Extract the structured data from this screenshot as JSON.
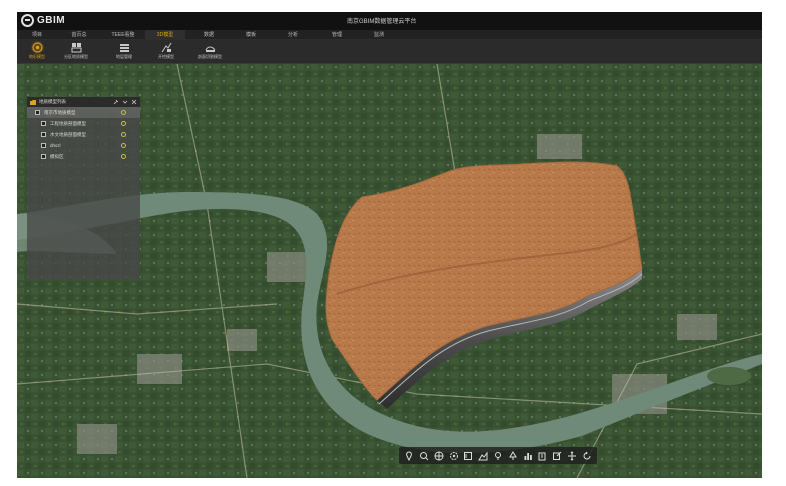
{
  "app": {
    "logo_text": "GBIM",
    "title": "南京GBIM数据管理云平台"
  },
  "menu": {
    "items": [
      {
        "label": "项目"
      },
      {
        "label": "首页总"
      },
      {
        "label": "TEEE看整"
      },
      {
        "label": "3D模型"
      },
      {
        "label": "数据"
      },
      {
        "label": "模板"
      },
      {
        "label": "分析"
      },
      {
        "label": "管理"
      },
      {
        "label": "监测"
      }
    ],
    "active_index": 3
  },
  "toolbar": {
    "tools": [
      {
        "label": "地形模型",
        "icon": "target-icon"
      },
      {
        "label": "分区地质模型",
        "icon": "grid-icon"
      },
      {
        "label": "地层管理",
        "icon": "layers-icon"
      },
      {
        "label": "开挖模型",
        "icon": "excavate-icon"
      },
      {
        "label": "剖面切割模型",
        "icon": "section-icon"
      }
    ],
    "active_index": 0
  },
  "panel": {
    "title": "地质模型列表",
    "rows": [
      {
        "label": "南京市地质模型",
        "selected": true
      },
      {
        "label": "工程地质剖面模型",
        "selected": false
      },
      {
        "label": "水文地质剖面模型",
        "selected": false
      },
      {
        "label": "dhszl",
        "selected": false
      },
      {
        "label": "模拟区",
        "selected": false
      }
    ]
  },
  "bottom_toolbar": {
    "icons": [
      "location-icon",
      "zoom-icon",
      "globe-icon",
      "settings-icon",
      "measure-icon",
      "terrain-icon",
      "pin-icon",
      "tree-icon",
      "chart-icon",
      "building-icon",
      "edit-icon",
      "move-icon",
      "rotate-icon"
    ]
  },
  "colors": {
    "accent": "#e0a020",
    "model_fill": "#b8794a",
    "river": "#6f8a78",
    "farmland": "#3f5a37"
  }
}
